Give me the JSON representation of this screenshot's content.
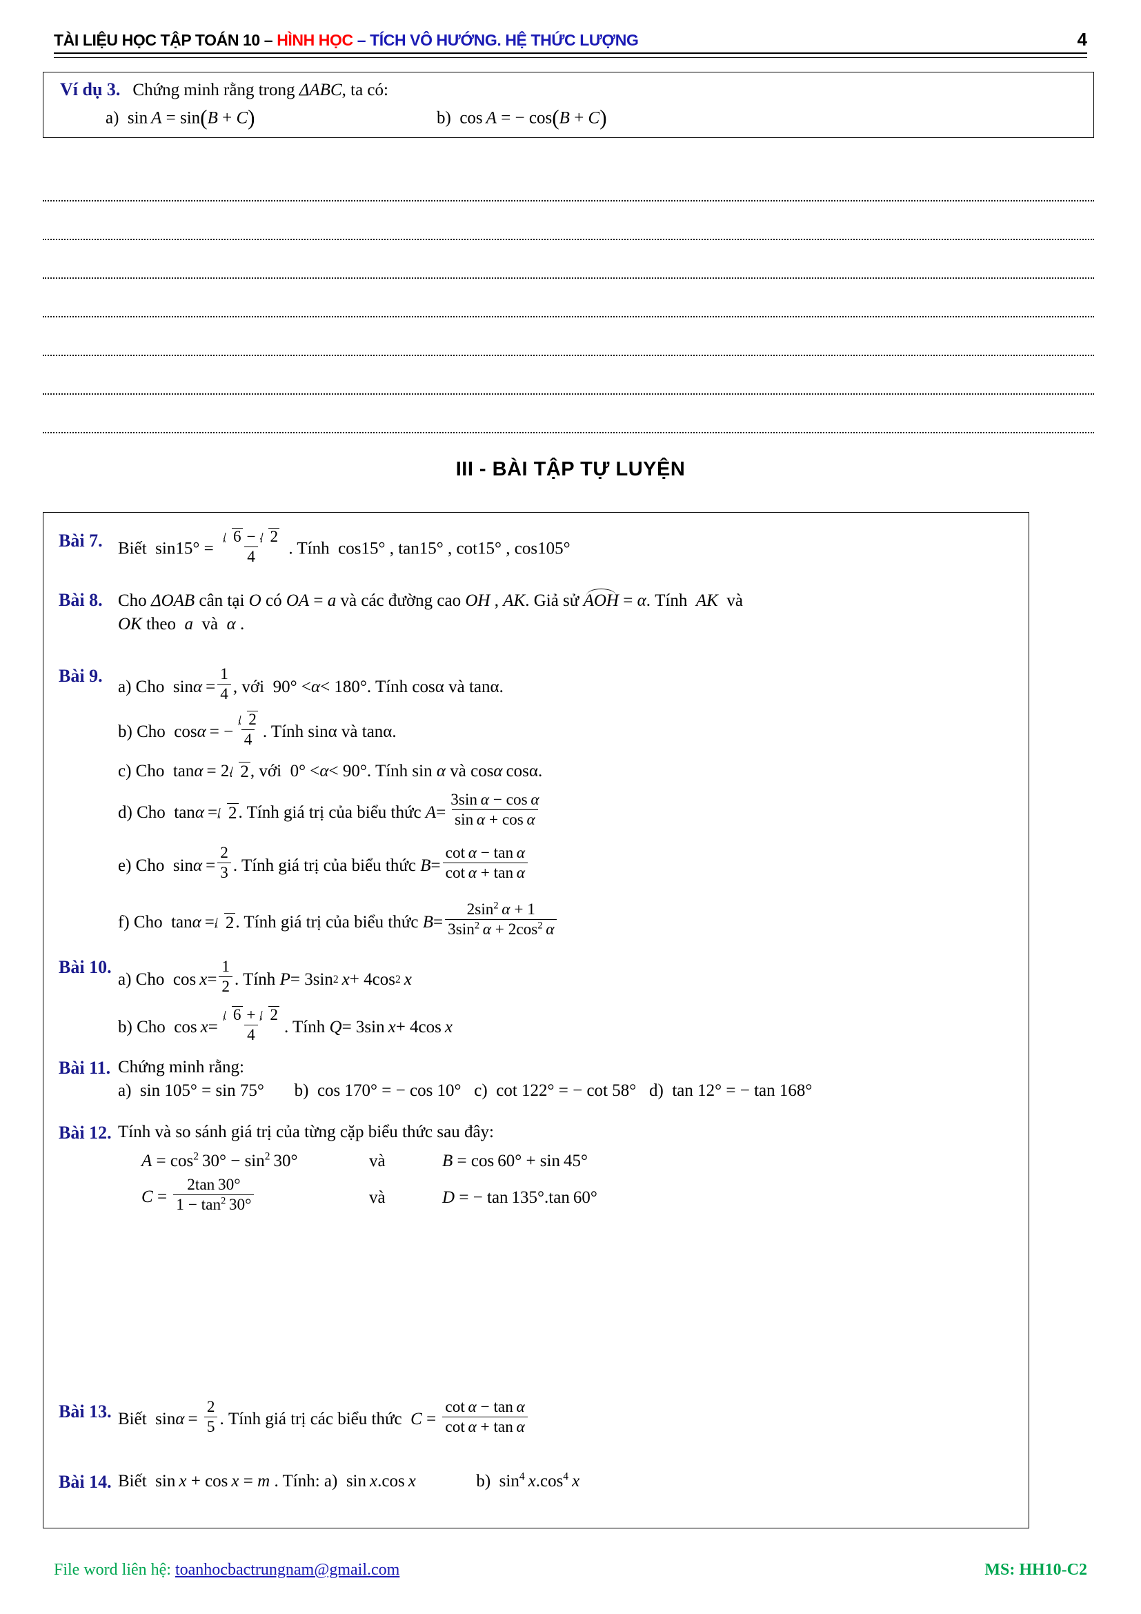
{
  "header": {
    "title_black": "TÀI LIỆU HỌC TẬP TOÁN 10 – ",
    "title_red": "HÌNH HỌC",
    "title_blue": " – TÍCH VÔ HƯỚNG. HỆ THỨC LƯỢNG",
    "page_number": "4"
  },
  "example": {
    "label": "Ví dụ 3.",
    "prompt_pre": "Chứng minh rằng trong ",
    "prompt_tri": "ΔABC",
    "prompt_post": ", ta có:",
    "item_a_marker": "a)",
    "item_a": "sin A = sin (B + C)",
    "item_b_marker": "b)",
    "item_b": "cos A = − cos (B + C)"
  },
  "answer_lines": {
    "count": 7
  },
  "section": {
    "heading": "III - BÀI TẬP TỰ LUYỆN"
  },
  "exercises": [
    {
      "label": "Bài 7.",
      "text_1": "Biết",
      "expr_sin15": "sin 15° =",
      "frac_num": "√6 − √2",
      "frac_den": "4",
      "text_2": ". Tính",
      "values": "cos 15° ,  tan 15° ,  cot 15° ,  cos 105°"
    },
    {
      "label": "Bài 8.",
      "line_1": "Cho ΔOAB cân tại O có OA = a và các đường cao OH , AK . Giả sử AOH = α . Tính AK và",
      "line_2": "OK theo a và α ."
    },
    {
      "label": "Bài 9.",
      "items": [
        {
          "marker": "a)",
          "text": "Cho sin α = 1/4 , với 90° < α < 180° . Tính cosα và tanα."
        },
        {
          "marker": "b)",
          "text": "Cho cos α = − √2/4 . Tính sinα và tanα."
        },
        {
          "marker": "c)",
          "text": "Cho tan α = 2√2 , với 0° < α < 90° . Tính sin α và cos α cosα."
        },
        {
          "marker": "d)",
          "text": "Cho tan α = √2 . Tính giá trị của biểu thức A = (3sin α − cos α)/(sin α + cos α)"
        },
        {
          "marker": "e)",
          "text": "Cho sin α = 2/3 . Tính giá trị của biểu thức B = (cot α − tan α)/(cot α + tan α)"
        },
        {
          "marker": "f)",
          "text": "Cho tan α = √2 . Tính giá trị của biểu thức B = (2sin² α + 1)/(3sin² α + 2cos² α)"
        }
      ]
    },
    {
      "label": "Bài 10.",
      "items": [
        {
          "marker": "a)",
          "text": "Cho cos x = 1/2 . Tính P = 3sin² x + 4cos² x"
        },
        {
          "marker": "b)",
          "text": "Cho cos x = (√6 + √2)/4 . Tính Q = 3sin x + 4cos x"
        }
      ]
    },
    {
      "label": "Bài 11.",
      "intro": "Chứng minh rằng:",
      "items": [
        {
          "marker": "a)",
          "text": "sin 105° = sin 75°"
        },
        {
          "marker": "b)",
          "text": "cos 170° = − cos 10°"
        },
        {
          "marker": "c)",
          "text": "cot 122° = − cot 58°"
        },
        {
          "marker": "d)",
          "text": "tan 12° = − tan 168°"
        }
      ]
    },
    {
      "label": "Bài 12.",
      "intro": "Tính và so sánh giá trị của từng cặp biểu thức sau đây:",
      "pair1_left": "A = cos² 30° − sin² 30°",
      "pair1_conj": "và",
      "pair1_right": "B = cos 60° + sin 45°",
      "pair2_left": "C = 2tan 30° / (1 − tan² 30°)",
      "pair2_conj": "và",
      "pair2_right": "D = − tan 135° . tan 60°"
    },
    {
      "label": "Bài 13.",
      "text": "Biết sin α = 2/5 . Tính giá trị các biểu thức C = (cot α − tan α)/(cot α + tan α)"
    },
    {
      "label": "Bài 14.",
      "text": "Biết sin x + cos x = m . Tính: a) sin x.cos x      b) sin⁴ x.cos⁴ x"
    }
  ],
  "labels": {
    "bai7": "Bài 7.",
    "bai8": "Bài 8.",
    "bai9": "Bài 9.",
    "bai10": "Bài 10.",
    "bai11": "Bài 11.",
    "bai12": "Bài 12.",
    "bai13": "Bài 13.",
    "bai14": "Bài 14."
  },
  "pieces": {
    "biet": "Biết",
    "tinh": ". Tính",
    "tinh_plain": "Tính",
    "cho": "Cho",
    "vi": "với",
    "va": "và",
    "tinh_gia_tri": ". Tính giá trị của biểu thức",
    "tinh_gia_tri_cac": ". Tính giá trị các biểu thức",
    "b7_values": "cos15° ,  tan15° ,  cot15° ,  cos105°",
    "b8_l1_a": "Cho",
    "b8_l1_b": "cân tại",
    "b8_l1_c": "có",
    "b8_l1_d": "và các đường cao",
    "b8_l1_e": ". Giả sử",
    "b8_l1_f": ". Tính",
    "b8_l1_g": "và",
    "b8_l2_a": "theo",
    "b8_l2_b": "và",
    "b9a_tinh": ". Tính cosα và tanα.",
    "b9b_tinh": ". Tính sinα và tanα.",
    "b9c_tinh": ". Tính sin",
    "b9c_end": "cosα.",
    "b10a_tinh": ". Tính",
    "b11_intro": "Chứng minh rằng:",
    "b12_intro": "Tính và so sánh giá trị của từng cặp biểu thức sau đây:",
    "b12_va": "và",
    "b14_biet": "Biết",
    "b14_tinh": ". Tính: a)",
    "b14_b": "b)"
  },
  "footer": {
    "left_prefix": "File word liên hệ: ",
    "email": "toanhocbactrungnam@gmail.com",
    "right": "MS: HH10-C2"
  },
  "colors": {
    "header_red": "#ff0000",
    "header_blue": "#1a1ab4",
    "label_blue": "#1a1a8c",
    "footer_green": "#00a651",
    "email_blue": "#1a1ab4"
  }
}
